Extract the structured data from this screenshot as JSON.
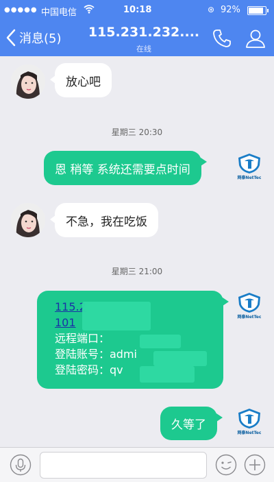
{
  "status_bar": {
    "signal": "●●●●●",
    "carrier": "中国电信",
    "time": "10:18",
    "battery_percent": "92%",
    "battery_level": 0.92
  },
  "nav": {
    "back_label": "消息(5)",
    "title": "115.231.232....",
    "subtitle": "在线"
  },
  "messages": [
    {
      "direction": "incoming",
      "text": "放心吧"
    },
    {
      "type": "time",
      "text": "星期三 20:30"
    },
    {
      "direction": "outgoing",
      "text": "恩 稍等 系统还需要点时间"
    },
    {
      "direction": "incoming",
      "text": "不急，我在吃饭"
    },
    {
      "type": "time",
      "text": "星期三 21:00"
    },
    {
      "direction": "outgoing",
      "lines": [
        "115.2",
        "101",
        "远程端口：",
        "登陆账号：admi",
        "登陆密码：qv"
      ]
    },
    {
      "direction": "outgoing",
      "text": "久等了"
    }
  ],
  "sender_brand": "网泰NetTec",
  "input": {
    "placeholder": ""
  },
  "colors": {
    "nav_bg": "#4e86f0",
    "outgoing_bubble": "#1dc98f",
    "incoming_bubble": "#ffffff",
    "chat_bg": "#ececf1"
  }
}
